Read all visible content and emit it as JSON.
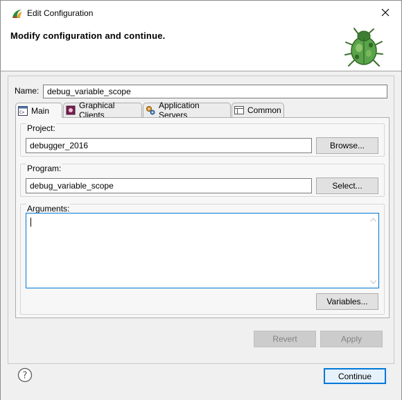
{
  "window": {
    "title": "Edit Configuration",
    "close_label": "Close"
  },
  "banner": {
    "heading": "Modify configuration and continue."
  },
  "form": {
    "name_label": "Name:",
    "name_value": "debug_variable_scope"
  },
  "tabs": [
    {
      "label": "Main",
      "icon": "main-tab-icon",
      "active": true
    },
    {
      "label": "Graphical Clients",
      "icon": "graphical-clients-icon",
      "active": false
    },
    {
      "label": "Application Servers",
      "icon": "application-servers-icon",
      "active": false
    },
    {
      "label": "Common",
      "icon": "common-icon",
      "active": false
    }
  ],
  "main_tab": {
    "project": {
      "label": "Project:",
      "value": "debugger_2016",
      "button": "Browse..."
    },
    "program": {
      "label": "Program:",
      "value": "debug_variable_scope",
      "button": "Select..."
    },
    "arguments": {
      "label": "Arguments:",
      "value": "",
      "button": "Variables..."
    }
  },
  "actions": {
    "revert": "Revert",
    "apply": "Apply",
    "continue": "Continue"
  },
  "colors": {
    "accent": "#0078d7",
    "panel_bg": "#f0f0f0",
    "disabled_btn": "#cccccc"
  }
}
